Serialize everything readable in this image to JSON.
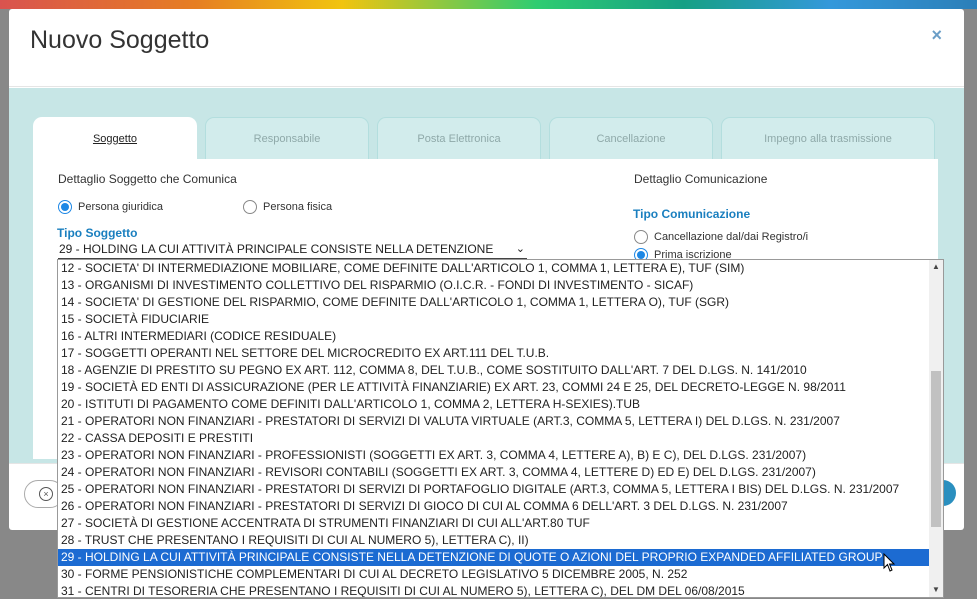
{
  "modal": {
    "title": "Nuovo Soggetto",
    "close_icon": "close-icon"
  },
  "tabs": [
    {
      "label": "Soggetto",
      "active": true
    },
    {
      "label": "Responsabile",
      "active": false
    },
    {
      "label": "Posta Elettronica",
      "active": false
    },
    {
      "label": "Cancellazione",
      "active": false
    },
    {
      "label": "Impegno alla trasmissione",
      "active": false
    }
  ],
  "left": {
    "section_title": "Dettaglio Soggetto che Comunica",
    "radio_giuridica": "Persona giuridica",
    "radio_fisica": "Persona fisica",
    "tipo_label": "Tipo Soggetto",
    "selected_value": "29 - HOLDING LA CUI ATTIVITÀ PRINCIPALE CONSISTE NELLA DETENZIONE"
  },
  "right": {
    "section_title": "Dettaglio Comunicazione",
    "tipo_label": "Tipo Comunicazione",
    "radio_cancellazione": "Cancellazione dal/dai Registro/i",
    "radio_prima": "Prima iscrizione"
  },
  "dropdown": {
    "options": [
      "12 - SOCIETA' DI INTERMEDIAZIONE MOBILIARE, COME DEFINITE DALL'ARTICOLO 1, COMMA 1, LETTERA E), TUF (SIM)",
      "13 - ORGANISMI DI INVESTIMENTO COLLETTIVO DEL RISPARMIO (O.I.C.R. - FONDI DI INVESTIMENTO - SICAF)",
      "14 - SOCIETA' DI GESTIONE DEL RISPARMIO, COME DEFINITE DALL'ARTICOLO 1, COMMA 1, LETTERA O), TUF (SGR)",
      "15 - SOCIETÀ FIDUCIARIE",
      "16 - ALTRI INTERMEDIARI (CODICE RESIDUALE)",
      "17 - SOGGETTI OPERANTI NEL SETTORE DEL MICROCREDITO EX ART.111 DEL T.U.B.",
      "18 - AGENZIE DI PRESTITO SU PEGNO EX ART. 112, COMMA 8, DEL T.U.B., COME SOSTITUITO DALL'ART. 7 DEL D.LGS. N. 141/2010",
      "19 - SOCIETÀ ED ENTI DI ASSICURAZIONE (PER LE ATTIVITÀ FINANZIARIE) EX ART. 23, COMMI 24 E 25, DEL DECRETO-LEGGE N. 98/2011",
      "20 - ISTITUTI DI PAGAMENTO COME DEFINITI DALL'ARTICOLO 1, COMMA 2, LETTERA H-SEXIES).TUB",
      "21 - OPERATORI NON FINANZIARI - PRESTATORI DI SERVIZI DI VALUTA VIRTUALE (ART.3, COMMA 5, LETTERA I) DEL D.LGS. N. 231/2007",
      "22 - CASSA DEPOSITI E PRESTITI",
      "23 - OPERATORI NON FINANZIARI - PROFESSIONISTI (SOGGETTI EX ART. 3, COMMA 4, LETTERE A), B) E C), DEL D.LGS. 231/2007)",
      "24 - OPERATORI NON FINANZIARI - REVISORI CONTABILI (SOGGETTI EX ART. 3, COMMA 4, LETTERE D) ED E) DEL D.LGS. 231/2007)",
      "25 - OPERATORI NON FINANZIARI - PRESTATORI DI SERVIZI DI PORTAFOGLIO DIGITALE (ART.3, COMMA 5, LETTERA I BIS) DEL D.LGS. N. 231/2007",
      "26 - OPERATORI NON FINANZIARI - PRESTATORI DI SERVIZI DI GIOCO DI CUI AL COMMA 6 DELL'ART. 3 DEL D.LGS. N. 231/2007",
      "27 - SOCIETÀ DI GESTIONE ACCENTRATA DI STRUMENTI FINANZIARI DI CUI ALL'ART.80 TUF",
      "28 - TRUST CHE PRESENTANO I REQUISITI DI CUI AL NUMERO 5), LETTERA C), II)",
      "29 - HOLDING LA CUI ATTIVITÀ PRINCIPALE CONSISTE NELLA DETENZIONE DI QUOTE O AZIONI DEL PROPRIO EXPANDED AFFILIATED GROUP",
      "30 - FORME PENSIONISTICHE COMPLEMENTARI DI CUI AL DECRETO LEGISLATIVO 5 DICEMBRE 2005, N. 252",
      "31 - CENTRI DI TESORERIA CHE PRESENTANO I REQUISITI DI CUI AL NUMERO 5), LETTERA C), DEL DM DEL 06/08/2015"
    ],
    "selected_index": 17
  },
  "colors": {
    "accent": "#1a7fbf",
    "selected_bg": "#1c6bd2",
    "body_bg": "#c7e6e6"
  }
}
